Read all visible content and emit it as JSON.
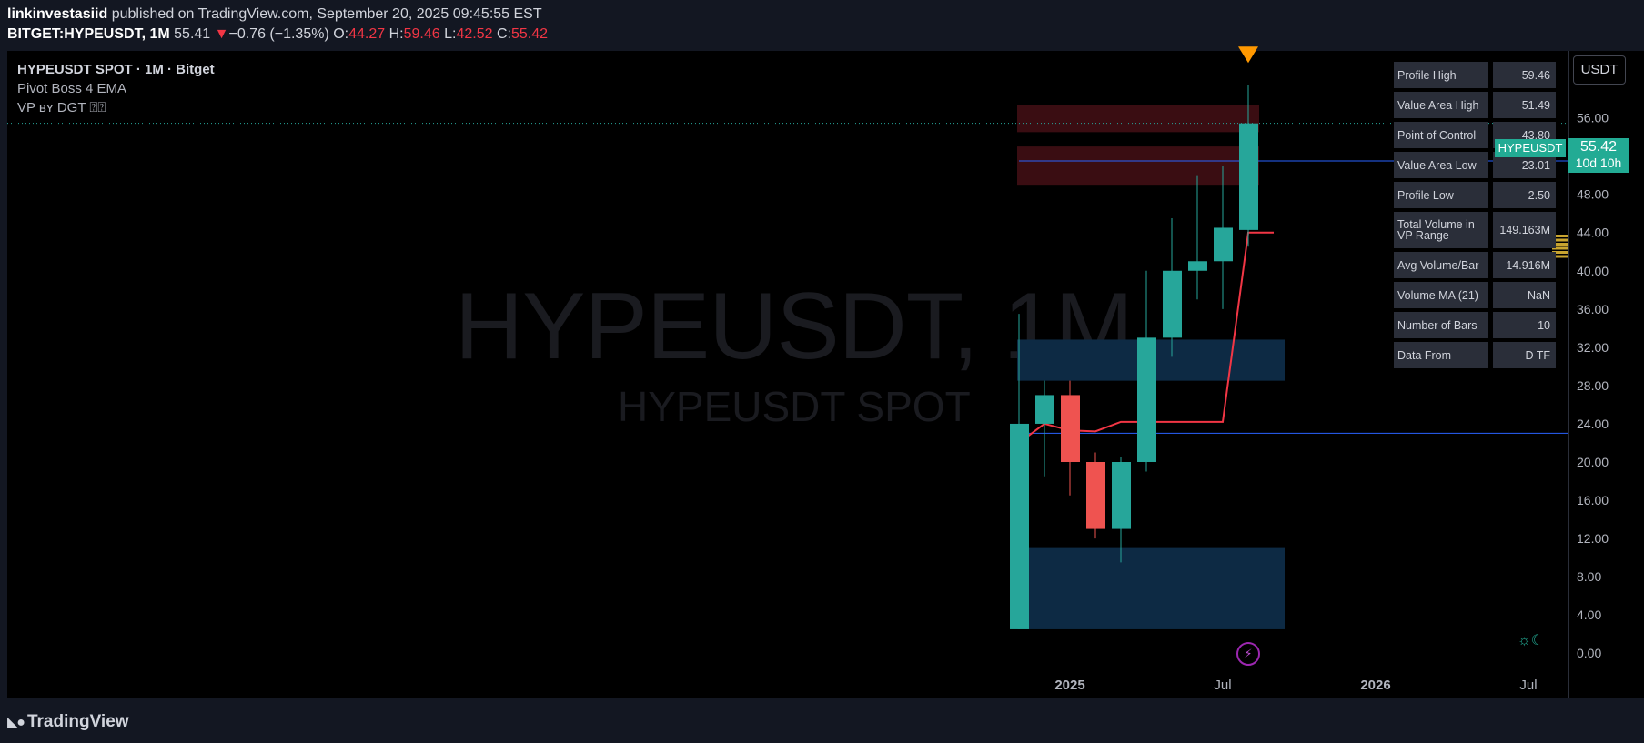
{
  "publish": {
    "author": "linkinvestasiid",
    "text": " published on TradingView.com, September 20, 2025 09:45:55 EST"
  },
  "ohlc": {
    "symbol": "BITGET:HYPEUSDT, 1M",
    "last": "55.41",
    "arrow": "▼",
    "change": "−0.76 (−1.35%)",
    "o_label": "O:",
    "o": "44.27",
    "h_label": "H:",
    "h": "59.46",
    "l_label": "L:",
    "l": "42.52",
    "c_label": "C:",
    "c": "55.42"
  },
  "legend": {
    "line1": "HYPEUSDT SPOT · 1M · Bitget",
    "line2": "Pivot Boss 4 EMA",
    "line3": "VP ʙʏ DGT ⍰⍰"
  },
  "watermark": {
    "main": "HYPEUSDT, 1M",
    "sub": "HYPEUSDT SPOT"
  },
  "currency_button": "USDT",
  "price_label": {
    "value": "55.42",
    "countdown": "10d 10h",
    "symbol": "HYPEUSDT"
  },
  "vp_table": [
    {
      "label": "Profile High",
      "value": "59.46"
    },
    {
      "label": "Value Area High",
      "value": "51.49"
    },
    {
      "label": "Point of Control",
      "value": "43.80"
    },
    {
      "label": "Value Area Low",
      "value": "23.01"
    },
    {
      "label": "Profile Low",
      "value": "2.50"
    },
    {
      "label": "Total Volume in VP Range",
      "value": "149.163M"
    },
    {
      "label": "Avg Volume/Bar",
      "value": "14.916M"
    },
    {
      "label": "Volume MA (21)",
      "value": "NaN"
    },
    {
      "label": "Number of Bars",
      "value": "10"
    },
    {
      "label": "Data From",
      "value": "D TF"
    }
  ],
  "footer": {
    "logo_text": "TradingView"
  },
  "icons": {
    "daynight": "sun-moon-icon",
    "bolt": "lightning-icon",
    "logo": "tradingview-logo-icon"
  },
  "colors": {
    "up": "#26a69a",
    "down": "#ef5350",
    "ema": "#f23645",
    "hline": "#2962ff",
    "supply": "#3a0d12",
    "demand": "#0d2a44",
    "marker": "#ff9800"
  },
  "chart_data": {
    "type": "candlestick",
    "y_range": [
      -1.5,
      63
    ],
    "y_ticks": [
      "0.00",
      "4.00",
      "8.00",
      "12.00",
      "16.00",
      "20.00",
      "24.00",
      "28.00",
      "32.00",
      "36.00",
      "40.00",
      "44.00",
      "48.00",
      "52.00",
      "56.00",
      "60.00"
    ],
    "x_ticks": [
      {
        "label": "2025",
        "date": "2025-01"
      },
      {
        "label": "Jul",
        "date": "2025-07"
      },
      {
        "label": "2026",
        "date": "2026-01"
      },
      {
        "label": "Jul",
        "date": "2026-07"
      }
    ],
    "candles": [
      {
        "date": "2024-11",
        "o": 2.5,
        "h": 35.5,
        "l": 2.5,
        "c": 24.0
      },
      {
        "date": "2024-12",
        "o": 24.0,
        "h": 28.5,
        "l": 18.5,
        "c": 27.0
      },
      {
        "date": "2025-01",
        "o": 27.0,
        "h": 28.5,
        "l": 16.5,
        "c": 20.0
      },
      {
        "date": "2025-02",
        "o": 20.0,
        "h": 21.0,
        "l": 12.0,
        "c": 13.0
      },
      {
        "date": "2025-03",
        "o": 13.0,
        "h": 20.5,
        "l": 9.5,
        "c": 20.0
      },
      {
        "date": "2025-04",
        "o": 20.0,
        "h": 40.0,
        "l": 19.0,
        "c": 33.0
      },
      {
        "date": "2025-05",
        "o": 33.0,
        "h": 45.5,
        "l": 31.0,
        "c": 40.0
      },
      {
        "date": "2025-06",
        "o": 40.0,
        "h": 50.0,
        "l": 37.0,
        "c": 41.0
      },
      {
        "date": "2025-07",
        "o": 41.0,
        "h": 51.0,
        "l": 36.0,
        "c": 44.5
      },
      {
        "date": "2025-08",
        "o": 44.27,
        "h": 59.46,
        "l": 42.52,
        "c": 55.42
      }
    ],
    "ema": [
      {
        "date": "2024-11",
        "value": 22.0
      },
      {
        "date": "2024-12",
        "value": 24.0
      },
      {
        "date": "2025-01",
        "value": 23.3
      },
      {
        "date": "2025-02",
        "value": 23.2
      },
      {
        "date": "2025-03",
        "value": 24.2
      },
      {
        "date": "2025-04",
        "value": 24.2
      },
      {
        "date": "2025-05",
        "value": 24.2
      },
      {
        "date": "2025-06",
        "value": 24.2
      },
      {
        "date": "2025-07",
        "value": 24.2
      },
      {
        "date": "2025-08",
        "value": 44.0
      },
      {
        "date": "2025-09",
        "value": 44.0
      }
    ],
    "horizontal_lines": [
      {
        "name": "Value Area High",
        "value": 51.49
      },
      {
        "name": "Value Area Low",
        "value": 23.01
      }
    ],
    "last_price": 55.42,
    "zones": [
      {
        "kind": "supply",
        "from": "2024-11",
        "to": "2025-08",
        "y0": 54.5,
        "y1": 57.3
      },
      {
        "kind": "supply",
        "from": "2024-11",
        "to": "2025-08",
        "y0": 49.0,
        "y1": 53.0
      },
      {
        "kind": "demand",
        "from": "2024-11",
        "to": "2025-09",
        "y0": 28.5,
        "y1": 32.8
      },
      {
        "kind": "demand",
        "from": "2024-11",
        "to": "2025-09",
        "y0": 2.5,
        "y1": 11.0
      }
    ],
    "marker": {
      "date": "2025-08",
      "price": 59.46
    }
  }
}
